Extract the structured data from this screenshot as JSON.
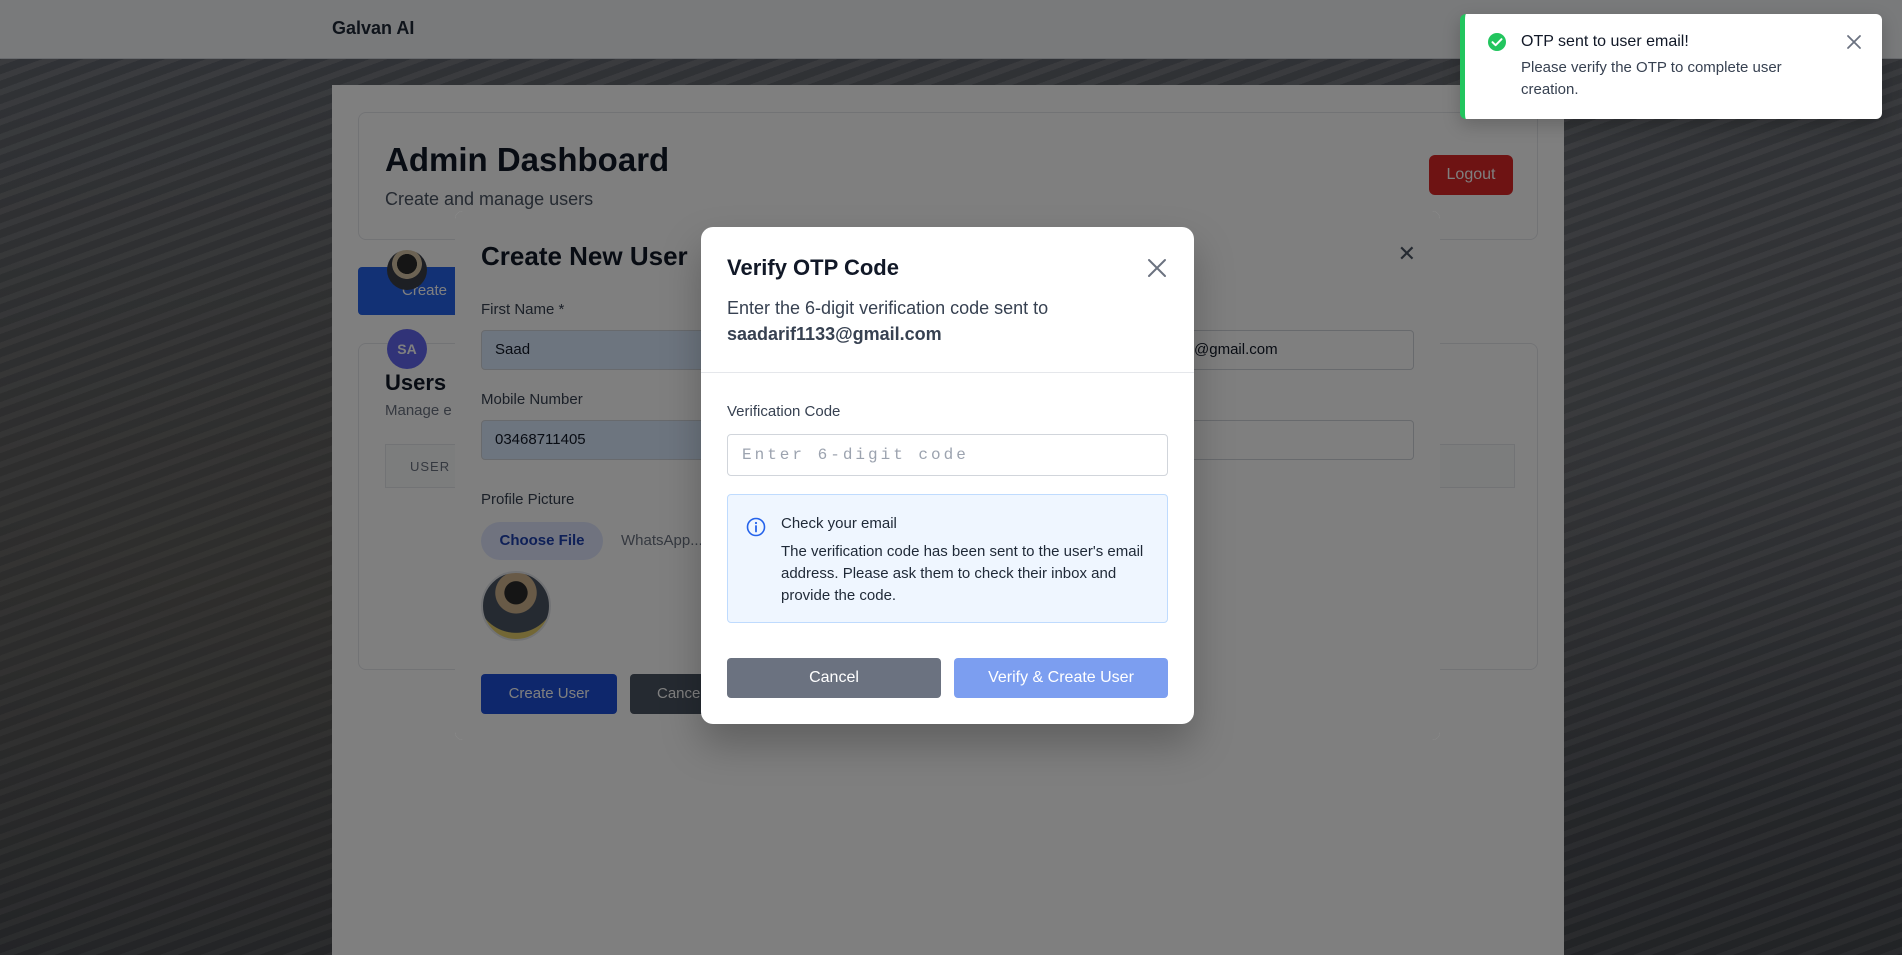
{
  "app": {
    "brand": "Galvan AI"
  },
  "dashboard": {
    "title": "Admin Dashboard",
    "subtitle": "Create and manage users",
    "logout_label": "Logout",
    "create_tab_label": "Create",
    "users_title": "Users",
    "users_subtitle": "Manage e",
    "table_header_user": "USER",
    "avatar_initials": "SA"
  },
  "create_user_modal": {
    "title": "Create New User",
    "first_name_label": "First Name *",
    "first_name_value": "Saad",
    "email_value": "133@gmail.com",
    "mobile_label": "Mobile Number",
    "mobile_value": "03468711405",
    "profile_picture_label": "Profile Picture",
    "choose_file_label": "Choose File",
    "file_name": "WhatsApp...",
    "create_button": "Create User",
    "cancel_button": "Cance"
  },
  "otp_modal": {
    "title": "Verify OTP Code",
    "description": "Enter the 6-digit verification code sent to",
    "email": "saadarif1133@gmail.com",
    "code_label": "Verification Code",
    "code_placeholder": "Enter 6-digit code",
    "info_title": "Check your email",
    "info_body": "The verification code has been sent to the user's email address. Please ask them to check their inbox and provide the code.",
    "cancel_button": "Cancel",
    "verify_button": "Verify & Create User"
  },
  "toast": {
    "title": "OTP sent to user email!",
    "body": "Please verify the OTP to complete user creation.",
    "accent": "#22c55e"
  },
  "colors": {
    "primary": "#2563eb",
    "danger": "#dc2626",
    "verify_disabled": "#7c9ef0",
    "info_bg": "#eff6ff"
  }
}
